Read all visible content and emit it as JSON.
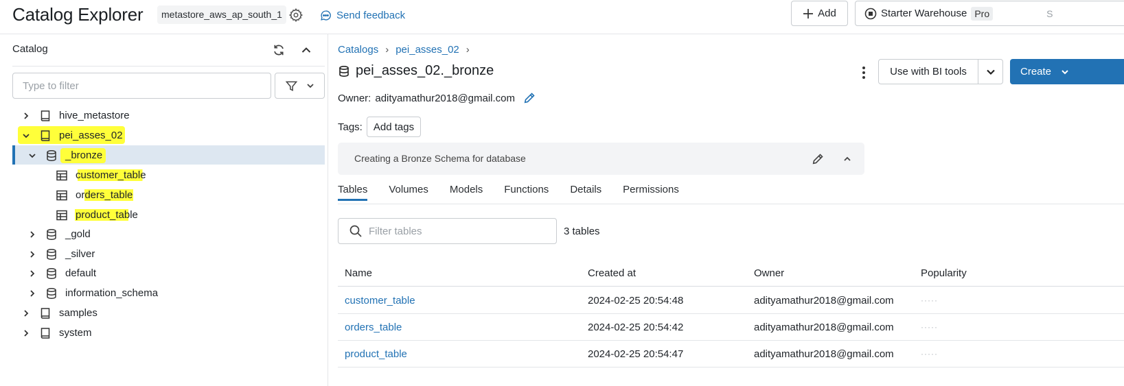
{
  "header": {
    "title": "Catalog Explorer",
    "metastore": "metastore_aws_ap_south_1",
    "feedback_label": "Send feedback",
    "add_label": "Add",
    "warehouse": {
      "name": "Starter Warehouse",
      "tier": "Pro",
      "suffix": "S"
    }
  },
  "sidebar": {
    "title": "Catalog",
    "filter_placeholder": "Type to filter",
    "tree": {
      "hive_metastore": "hive_metastore",
      "pei_asses_02": "pei_asses_02",
      "bronze": "_bronze",
      "customer_table": "customer_table",
      "orders_table": "orders_table",
      "product_table": "product_table",
      "gold": "_gold",
      "silver": "_silver",
      "default": "default",
      "information_schema": "information_schema",
      "samples": "samples",
      "system": "system"
    }
  },
  "main": {
    "breadcrumb": [
      "Catalogs",
      "pei_asses_02"
    ],
    "title": "pei_asses_02._bronze",
    "bi_tools_label": "Use with BI tools",
    "create_label": "Create",
    "owner_key": "Owner:",
    "owner_value": "adityamathur2018@gmail.com",
    "tags_key": "Tags:",
    "add_tags_label": "Add tags",
    "description": "Creating a Bronze Schema for database",
    "tabs": [
      "Tables",
      "Volumes",
      "Models",
      "Functions",
      "Details",
      "Permissions"
    ],
    "table_filter_placeholder": "Filter tables",
    "table_count": "3 tables",
    "columns": [
      "Name",
      "Created at",
      "Owner",
      "Popularity"
    ],
    "rows": [
      {
        "name": "customer_table",
        "created": "2024-02-25 20:54:48",
        "owner": "adityamathur2018@gmail.com"
      },
      {
        "name": "orders_table",
        "created": "2024-02-25 20:54:42",
        "owner": "adityamathur2018@gmail.com"
      },
      {
        "name": "product_table",
        "created": "2024-02-25 20:54:47",
        "owner": "adityamathur2018@gmail.com"
      }
    ]
  },
  "colors": {
    "accent": "#2272b4",
    "highlight": "#ffff3a",
    "selected_row": "#dde7f1"
  }
}
